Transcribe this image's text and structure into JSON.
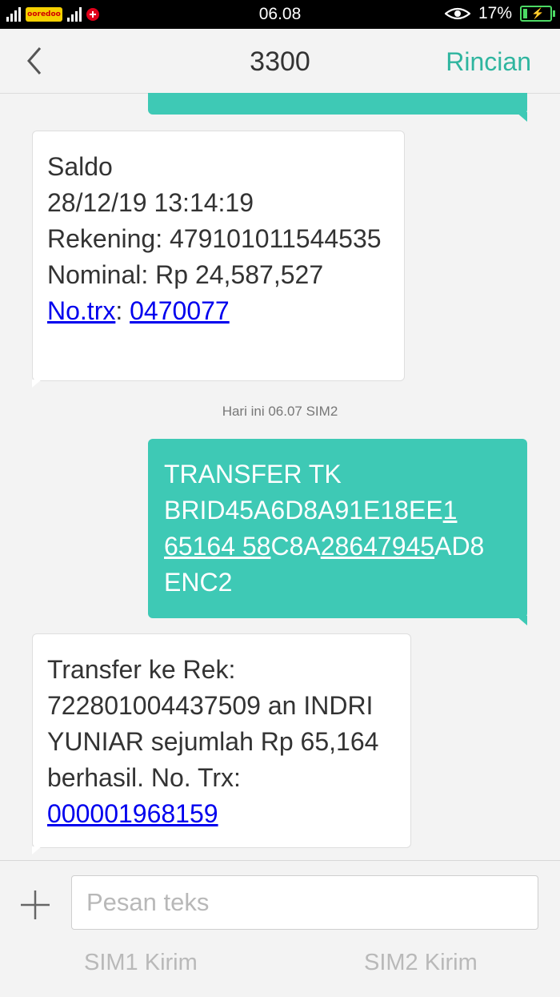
{
  "status_bar": {
    "operator_logo_text": "ooredoo",
    "time": "06.08",
    "battery": "17%",
    "battery_level": 0.17
  },
  "header": {
    "title": "3300",
    "detail_label": "Rincian"
  },
  "messages": {
    "saldo": {
      "line1": "Saldo",
      "line2": "28/12/19 13:14:19",
      "line3": "Rekening: 479101011544535",
      "line4": "Nominal: Rp 24,587,527",
      "trx_label": "No.trx",
      "trx_sep": ": ",
      "trx_value": "0470077"
    },
    "timestamp": "Hari ini  06.07  SIM2",
    "sent": {
      "line1": "TRANSFER TK",
      "seg1": "BRID45A6D8A91E18EE",
      "seg2": "1",
      "seg3": "65164 58",
      "seg4": "C8A",
      "seg5": "28647945",
      "seg6": "AD8",
      "line4": "ENC2"
    },
    "transfer_reply": {
      "line1": "Transfer ke Rek:",
      "line2": "722801004437509 an INDRI",
      "line3": "YUNIAR sejumlah Rp 65,164",
      "line4": "berhasil. No. Trx:",
      "trx_value": "000001968159"
    }
  },
  "composer": {
    "placeholder": "Pesan teks",
    "sim1_send": "SIM1 Kirim",
    "sim2_send": "SIM2 Kirim"
  }
}
